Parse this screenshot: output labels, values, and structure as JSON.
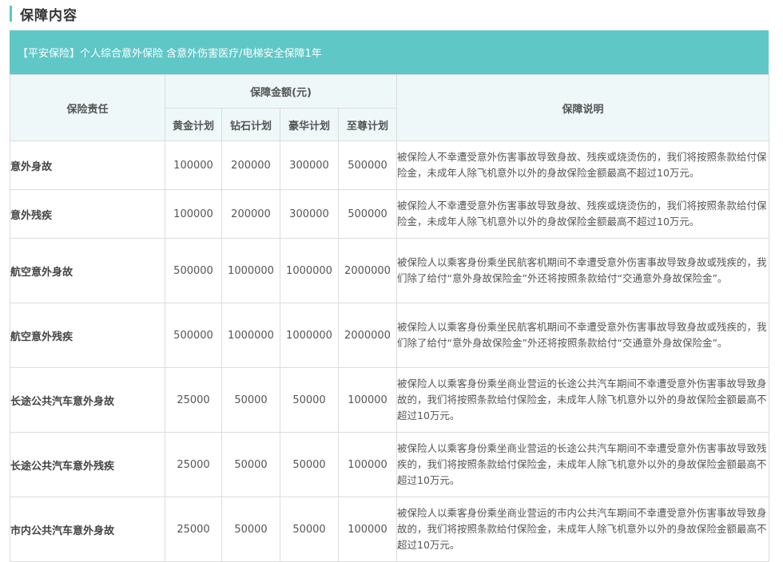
{
  "section": {
    "title": "保障内容"
  },
  "product": {
    "title": "【平安保险】个人综合意外保险 含意外伤害医疗/电梯安全保障1年"
  },
  "table": {
    "header": {
      "responsibility": "保险责任",
      "amount": "保障金额(元)",
      "plans": [
        "黄金计划",
        "钻石计划",
        "豪华计划",
        "至尊计划"
      ],
      "description": "保障说明"
    },
    "rows": [
      {
        "responsibility": "意外身故",
        "amounts": [
          "100000",
          "200000",
          "300000",
          "500000"
        ],
        "description": "被保险人不幸遭受意外伤害事故导致身故、残疾或烧烫伤的，我们将按照条款给付保险金，未成年人除飞机意外以外的身故保险金额最高不超过10万元。"
      },
      {
        "responsibility": "意外残疾",
        "amounts": [
          "100000",
          "200000",
          "300000",
          "500000"
        ],
        "description": "被保险人不幸遭受意外伤害事故导致身故、残疾或烧烫伤的，我们将按照条款给付保险金，未成年人除飞机意外以外的身故保险金额最高不超过10万元。"
      },
      {
        "responsibility": "航空意外身故",
        "amounts": [
          "500000",
          "1000000",
          "1000000",
          "2000000"
        ],
        "description": "被保险人以乘客身份乘坐民航客机期间不幸遭受意外伤害事故导致身故或残疾的，我们除了给付“意外身故保险金”外还将按照条款给付“交通意外身故保险金”。"
      },
      {
        "responsibility": "航空意外残疾",
        "amounts": [
          "500000",
          "1000000",
          "1000000",
          "2000000"
        ],
        "description": "被保险人以乘客身份乘坐民航客机期间不幸遭受意外伤害事故导致身故或残疾的，我们除了给付“意外身故保险金”外还将按照条款给付“交通意外身故保险金”。"
      },
      {
        "responsibility": "长途公共汽车意外身故",
        "amounts": [
          "25000",
          "50000",
          "50000",
          "100000"
        ],
        "description": "被保险人以乘客身份乘坐商业营运的长途公共汽车期间不幸遭受意外伤害事故导致身故的，我们将按照条款给付保险金，未成年人除飞机意外以外的身故保险金额最高不超过10万元。"
      },
      {
        "responsibility": "长途公共汽车意外残疾",
        "amounts": [
          "25000",
          "50000",
          "50000",
          "100000"
        ],
        "description": "被保险人以乘客身份乘坐商业营运的长途公共汽车期间不幸遭受意外伤害事故导致残疾的，我们将按照条款给付保险金，未成年人除飞机意外以外的身故保险金额最高不超过10万元。"
      },
      {
        "responsibility": "市内公共汽车意外身故",
        "amounts": [
          "25000",
          "50000",
          "50000",
          "100000"
        ],
        "description": "被保险人以乘客身份乘坐商业营运的市内公共汽车期间不幸遭受意外伤害事故导致身故的，我们将按照条款给付保险金，未成年人除飞机意外以外的身故保险金额最高不超过10万元。"
      }
    ]
  },
  "colors": {
    "accent": "#5ec6c5",
    "banner": "#60c7c7",
    "header_bg": "#eef8f8",
    "border": "#dcdcdc"
  }
}
